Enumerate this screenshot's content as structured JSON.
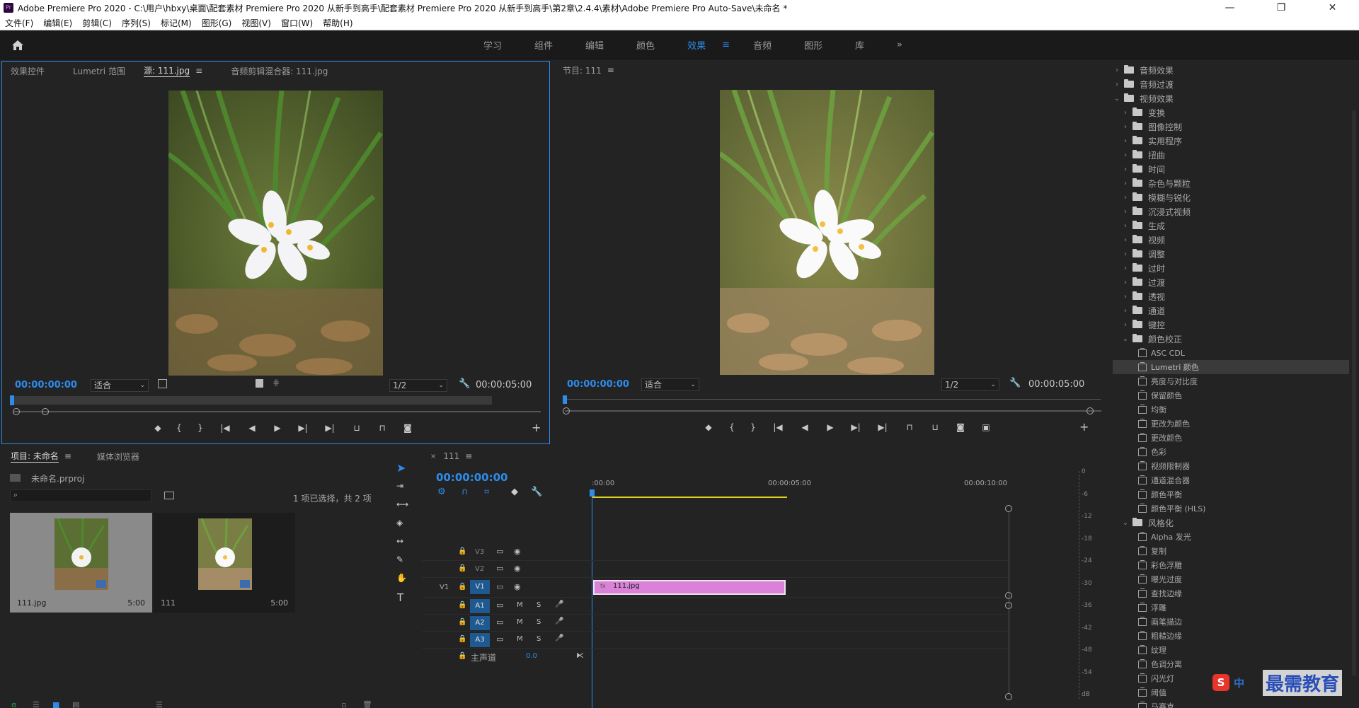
{
  "titlebar": {
    "app_icon": "Pr",
    "title": "Adobe Premiere Pro 2020 - C:\\用户\\hbxy\\桌面\\配套素材 Premiere Pro 2020 从新手到高手\\配套素材 Premiere Pro 2020 从新手到高手\\第2章\\2.4.4\\素材\\Adobe Premiere Pro Auto-Save\\未命名 *",
    "minimize": "—",
    "restore": "❐",
    "close": "✕"
  },
  "menu": [
    "文件(F)",
    "编辑(E)",
    "剪辑(C)",
    "序列(S)",
    "标记(M)",
    "图形(G)",
    "视图(V)",
    "窗口(W)",
    "帮助(H)"
  ],
  "workspaces": {
    "home_icon": "home-icon",
    "tabs": [
      "学习",
      "组件",
      "编辑",
      "颜色",
      "效果",
      "音频",
      "图形",
      "库"
    ],
    "active": "效果",
    "more": "»"
  },
  "source_panel": {
    "tabs": [
      "效果控件",
      "Lumetri 范围",
      "源: 111.jpg",
      "音频剪辑混合器: 111.jpg"
    ],
    "active_tab": "源: 111.jpg",
    "timecode_in": "00:00:00:00",
    "fit": "适合",
    "resolution": "1/2",
    "duration": "00:00:05:00"
  },
  "program_panel": {
    "title": "节目: 111",
    "timecode_in": "00:00:00:00",
    "fit": "适合",
    "resolution": "1/2",
    "duration": "00:00:05:00"
  },
  "effects_tree": [
    {
      "level": 0,
      "kind": "folder",
      "open": false,
      "label": "音频效果"
    },
    {
      "level": 0,
      "kind": "folder",
      "open": false,
      "label": "音频过渡"
    },
    {
      "level": 0,
      "kind": "folder",
      "open": true,
      "label": "视频效果"
    },
    {
      "level": 1,
      "kind": "folder",
      "open": false,
      "label": "变换"
    },
    {
      "level": 1,
      "kind": "folder",
      "open": false,
      "label": "图像控制"
    },
    {
      "level": 1,
      "kind": "folder",
      "open": false,
      "label": "实用程序"
    },
    {
      "level": 1,
      "kind": "folder",
      "open": false,
      "label": "扭曲"
    },
    {
      "level": 1,
      "kind": "folder",
      "open": false,
      "label": "时间"
    },
    {
      "level": 1,
      "kind": "folder",
      "open": false,
      "label": "杂色与颗粒"
    },
    {
      "level": 1,
      "kind": "folder",
      "open": false,
      "label": "模糊与锐化"
    },
    {
      "level": 1,
      "kind": "folder",
      "open": false,
      "label": "沉浸式视频"
    },
    {
      "level": 1,
      "kind": "folder",
      "open": false,
      "label": "生成"
    },
    {
      "level": 1,
      "kind": "folder",
      "open": false,
      "label": "视频"
    },
    {
      "level": 1,
      "kind": "folder",
      "open": false,
      "label": "调整"
    },
    {
      "level": 1,
      "kind": "folder",
      "open": false,
      "label": "过时"
    },
    {
      "level": 1,
      "kind": "folder",
      "open": false,
      "label": "过渡"
    },
    {
      "level": 1,
      "kind": "folder",
      "open": false,
      "label": "透视"
    },
    {
      "level": 1,
      "kind": "folder",
      "open": false,
      "label": "通道"
    },
    {
      "level": 1,
      "kind": "folder",
      "open": false,
      "label": "键控"
    },
    {
      "level": 1,
      "kind": "folder",
      "open": true,
      "label": "颜色校正"
    },
    {
      "level": 2,
      "kind": "effect",
      "label": "ASC CDL"
    },
    {
      "level": 2,
      "kind": "effect",
      "label": "Lumetri 颜色",
      "selected": true
    },
    {
      "level": 2,
      "kind": "effect",
      "label": "亮度与对比度"
    },
    {
      "level": 2,
      "kind": "effect",
      "label": "保留颜色"
    },
    {
      "level": 2,
      "kind": "effect",
      "label": "均衡"
    },
    {
      "level": 2,
      "kind": "effect",
      "label": "更改为颜色"
    },
    {
      "level": 2,
      "kind": "effect",
      "label": "更改颜色"
    },
    {
      "level": 2,
      "kind": "effect",
      "label": "色彩"
    },
    {
      "level": 2,
      "kind": "effect",
      "label": "视频限制器"
    },
    {
      "level": 2,
      "kind": "effect",
      "label": "通道混合器"
    },
    {
      "level": 2,
      "kind": "effect",
      "label": "颜色平衡"
    },
    {
      "level": 2,
      "kind": "effect",
      "label": "颜色平衡 (HLS)"
    },
    {
      "level": 1,
      "kind": "folder",
      "open": true,
      "label": "风格化"
    },
    {
      "level": 2,
      "kind": "effect",
      "label": "Alpha 发光"
    },
    {
      "level": 2,
      "kind": "effect",
      "label": "复制"
    },
    {
      "level": 2,
      "kind": "effect",
      "label": "彩色浮雕"
    },
    {
      "level": 2,
      "kind": "effect",
      "label": "曝光过度"
    },
    {
      "level": 2,
      "kind": "effect",
      "label": "查找边缘"
    },
    {
      "level": 2,
      "kind": "effect",
      "label": "浮雕"
    },
    {
      "level": 2,
      "kind": "effect",
      "label": "画笔描边"
    },
    {
      "level": 2,
      "kind": "effect",
      "label": "粗糙边缘"
    },
    {
      "level": 2,
      "kind": "effect",
      "label": "纹理"
    },
    {
      "level": 2,
      "kind": "effect",
      "label": "色调分离"
    },
    {
      "level": 2,
      "kind": "effect",
      "label": "闪光灯"
    },
    {
      "level": 2,
      "kind": "effect",
      "label": "阈值"
    },
    {
      "level": 2,
      "kind": "effect",
      "label": "马赛克"
    }
  ],
  "project_panel": {
    "tabs": [
      "项目: 未命名",
      "媒体浏览器"
    ],
    "project_file": "未命名.prproj",
    "selection_info": "1 项已选择，共 2 项",
    "items": [
      {
        "name": "111.jpg",
        "duration": "5:00",
        "selected": true
      },
      {
        "name": "111",
        "duration": "5:00",
        "selected": false
      }
    ]
  },
  "timeline": {
    "sequence": "111",
    "timecode": "00:00:00:00",
    "ruler": [
      ":00:00",
      "00:00:05:00",
      "00:00:10:00"
    ],
    "video_tracks": [
      "V3",
      "V2",
      "V1"
    ],
    "audio_tracks": [
      "A1",
      "A2",
      "A3"
    ],
    "source_patch": "V1",
    "master": "主声道",
    "master_value": "0.0",
    "clip_name": "111.jpg",
    "mute": "M",
    "solo": "S"
  },
  "meters": {
    "scale": [
      "0",
      "-6",
      "-12",
      "-18",
      "-24",
      "-30",
      "-36",
      "-42",
      "-48",
      "-54",
      "dB"
    ]
  },
  "watermark": {
    "ime": "中",
    "text": "最需教育"
  },
  "colors": {
    "accent": "#2d8ceb",
    "clip": "#d982d7",
    "track_badge": "#1e5a91",
    "selected_row": "#3a3a3a"
  }
}
